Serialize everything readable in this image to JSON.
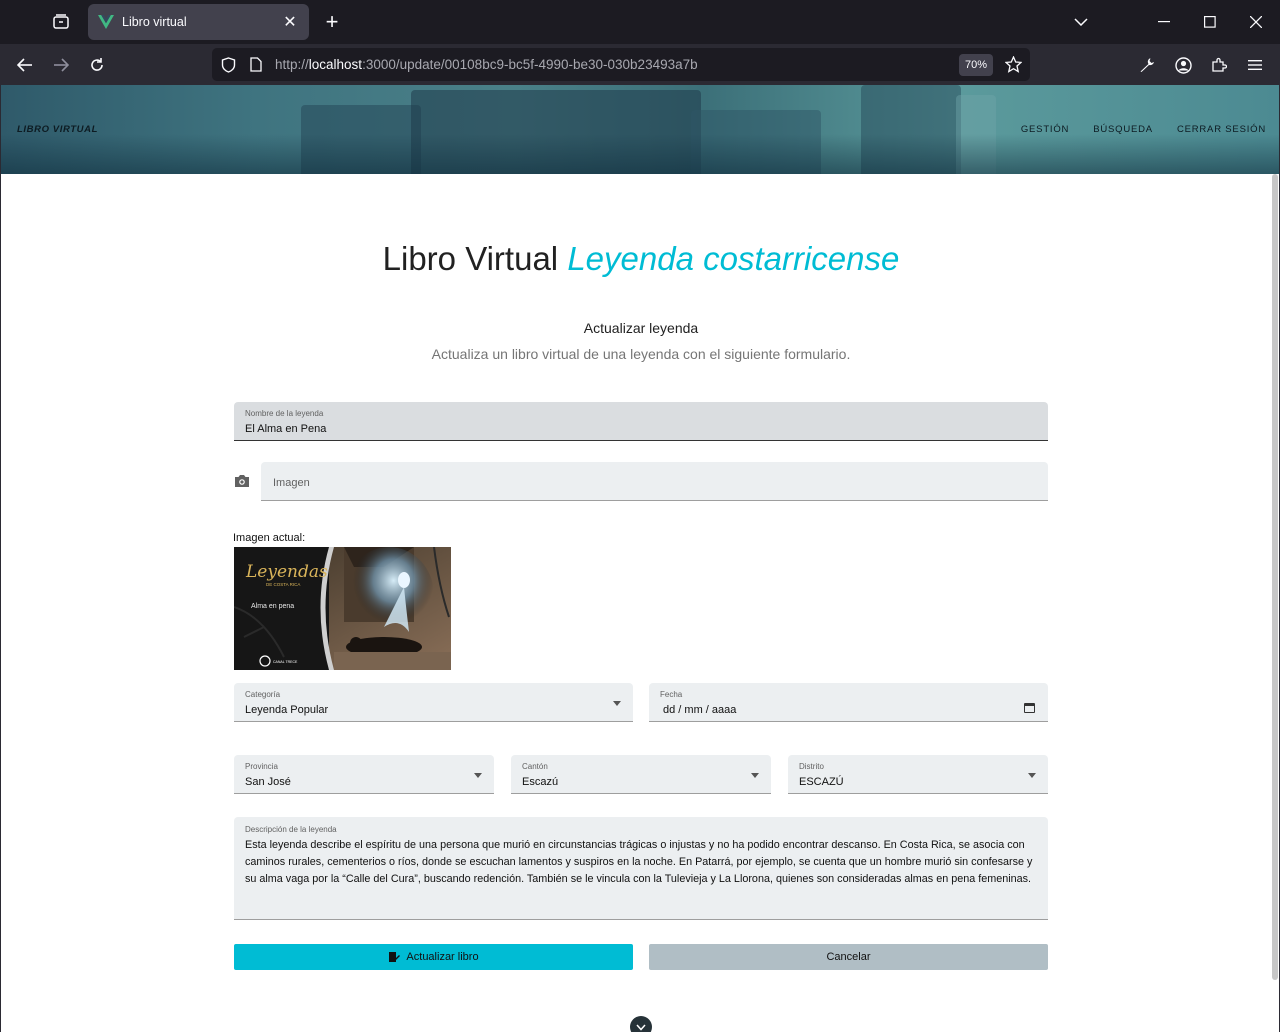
{
  "browser": {
    "tab_title": "Libro virtual",
    "url_prefix": "http://",
    "url_host": "localhost",
    "url_rest": ":3000/update/00108bc9-bc5f-4990-be30-030b23493a7b",
    "zoom": "70%"
  },
  "header": {
    "brand": "LIBRO VIRTUAL",
    "nav": [
      "GESTIÓN",
      "BÚSQUEDA",
      "CERRAR SESIÓN"
    ]
  },
  "page": {
    "title_main": "Libro Virtual",
    "title_accent": "Leyenda costarricense",
    "subtitle": "Actualizar leyenda",
    "description": "Actualiza un libro virtual de una leyenda con el siguiente formulario."
  },
  "form": {
    "name": {
      "label": "Nombre de la leyenda",
      "value": "El Alma en Pena"
    },
    "image": {
      "placeholder": "Imagen"
    },
    "current_image_label": "Imagen actual:",
    "thumbnail": {
      "title": "Leyendas",
      "subtitle": "DE COSTA RICA",
      "caption": "Alma en pena",
      "logo": "CANAL TRECE"
    },
    "category": {
      "label": "Categoría",
      "value": "Leyenda Popular"
    },
    "date": {
      "label": "Fecha",
      "value": "dd / mm / aaaa"
    },
    "province": {
      "label": "Provincia",
      "value": "San José"
    },
    "canton": {
      "label": "Cantón",
      "value": "Escazú"
    },
    "district": {
      "label": "Distrito",
      "value": "ESCAZÚ"
    },
    "legend_description": {
      "label": "Descripción de la leyenda",
      "value": "Esta leyenda describe el espíritu de una persona que murió en circunstancias trágicas o injustas y no ha podido encontrar descanso. En Costa Rica, se asocia con caminos rurales, cementerios o ríos, donde se escuchan lamentos y suspiros en la noche. En Patarrá, por ejemplo, se cuenta que un hombre murió sin confesarse y su alma vaga por la “Calle del Cura”, buscando redención. También se le vincula con la Tulevieja y La Llorona, quienes son consideradas almas en pena femeninas."
    },
    "submit_label": "Actualizar libro",
    "cancel_label": "Cancelar"
  },
  "colors": {
    "accent": "#00bcd4",
    "cancel": "#b0bec5",
    "field_bg": "#eceff1"
  }
}
